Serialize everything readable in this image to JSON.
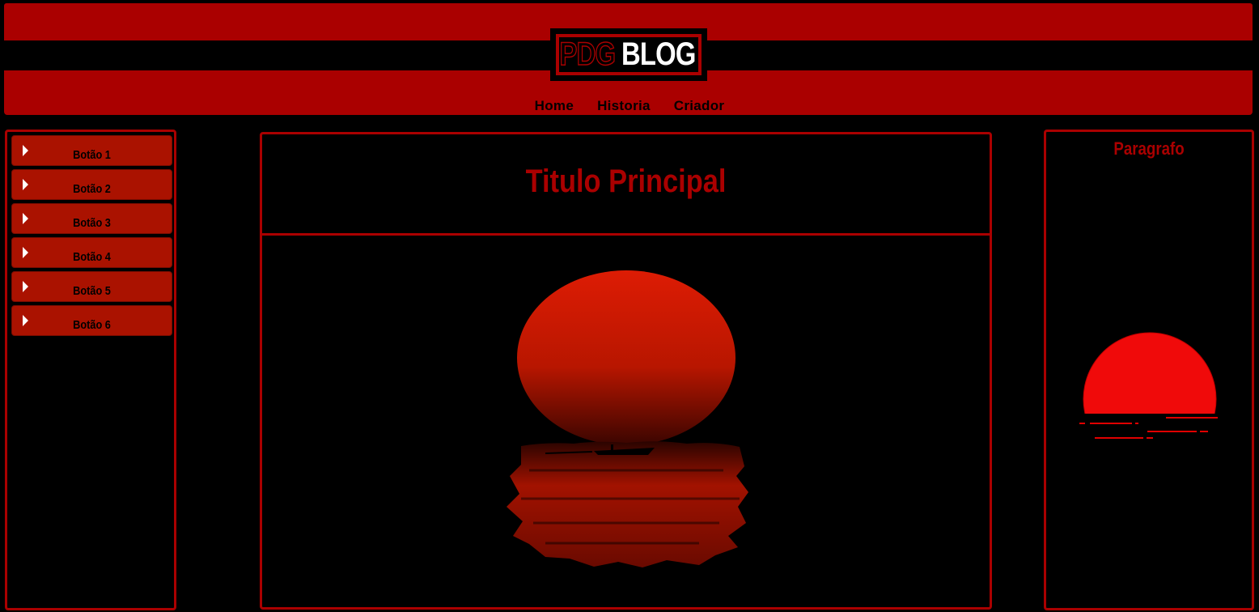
{
  "header": {
    "logo_left": "PDG",
    "logo_right": "BLOG",
    "nav": [
      "Home",
      "Historia",
      "Criador"
    ]
  },
  "sidebar": {
    "buttons": [
      "Botão 1",
      "Botão 2",
      "Botão 3",
      "Botão 4",
      "Botão 5",
      "Botão 6"
    ]
  },
  "main": {
    "title": "Titulo Principal",
    "image": "red sunset over water with boat silhouette"
  },
  "aside": {
    "title": "Paragrafo",
    "image": "red setting sun icon"
  },
  "colors": {
    "brand_red": "#aa0000",
    "button_red": "#aa1200",
    "background": "#000000"
  }
}
